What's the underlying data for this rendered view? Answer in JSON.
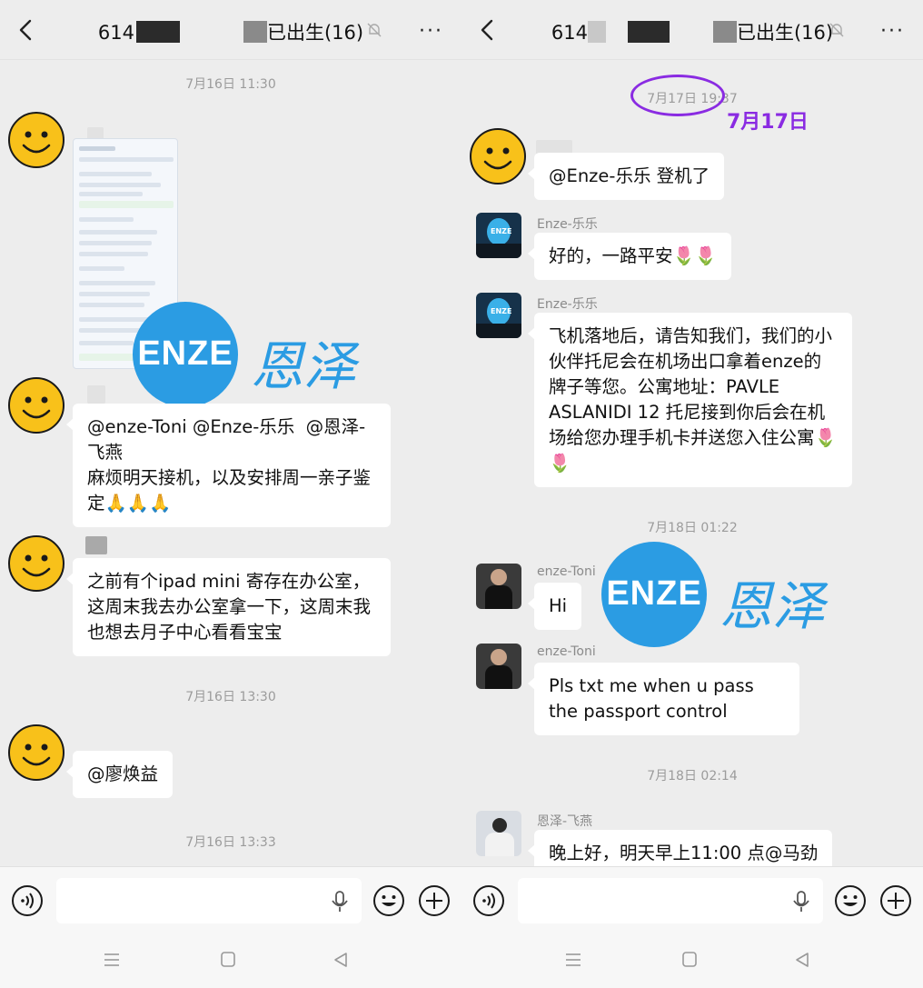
{
  "left": {
    "header": {
      "title_prefix": "614",
      "title_suffix": "已出生(16)",
      "more": "···"
    },
    "timestamps": [
      "7月16日 11:30",
      "7月16日 13:30",
      "7月16日 13:33"
    ],
    "messages": [
      {
        "type": "image",
        "description": "screenshot"
      },
      {
        "type": "text",
        "text": "@enze-Toni @Enze-乐乐  @恩泽-飞燕\n麻烦明天接机，以及安排周一亲子鉴定🙏🙏🙏"
      },
      {
        "type": "text",
        "text": "之前有个ipad mini 寄存在办公室，这周末我去办公室拿一下，这周末我也想去月子中心看看宝宝"
      },
      {
        "type": "text",
        "text": "@廖焕益"
      }
    ]
  },
  "right": {
    "header": {
      "title_prefix": "614",
      "title_suffix": "已出生(16)",
      "more": "···"
    },
    "annotation": "7月17日",
    "timestamps": [
      "7月17日 19:37",
      "7月18日 01:22",
      "7月18日 02:14"
    ],
    "messages": [
      {
        "sender": "",
        "text": "@Enze-乐乐  登机了"
      },
      {
        "sender": "Enze-乐乐",
        "text": "好的，一路平安🌷🌷"
      },
      {
        "sender": "Enze-乐乐",
        "text": "飞机落地后，请告知我们，我们的小伙伴托尼会在机场出口拿着enze的牌子等您。公寓地址：PAVLE ASLANIDI 12 托尼接到你后会在机场给您办理手机卡并送您入住公寓🌷🌷"
      },
      {
        "sender": "enze-Toni",
        "text": "Hi"
      },
      {
        "sender": "enze-Toni",
        "text": "Pls txt me when u pass the passport control"
      },
      {
        "sender": "恩泽-飞燕",
        "text": "晚上好，明天早上11:00 点@马劲"
      }
    ]
  },
  "watermark": {
    "logo_text": "ENZE",
    "cn_text": "恩泽"
  },
  "colors": {
    "bg": "#ededed",
    "bubble": "#ffffff",
    "annotation": "#8a2be2",
    "brand": "#2b9ce3"
  }
}
